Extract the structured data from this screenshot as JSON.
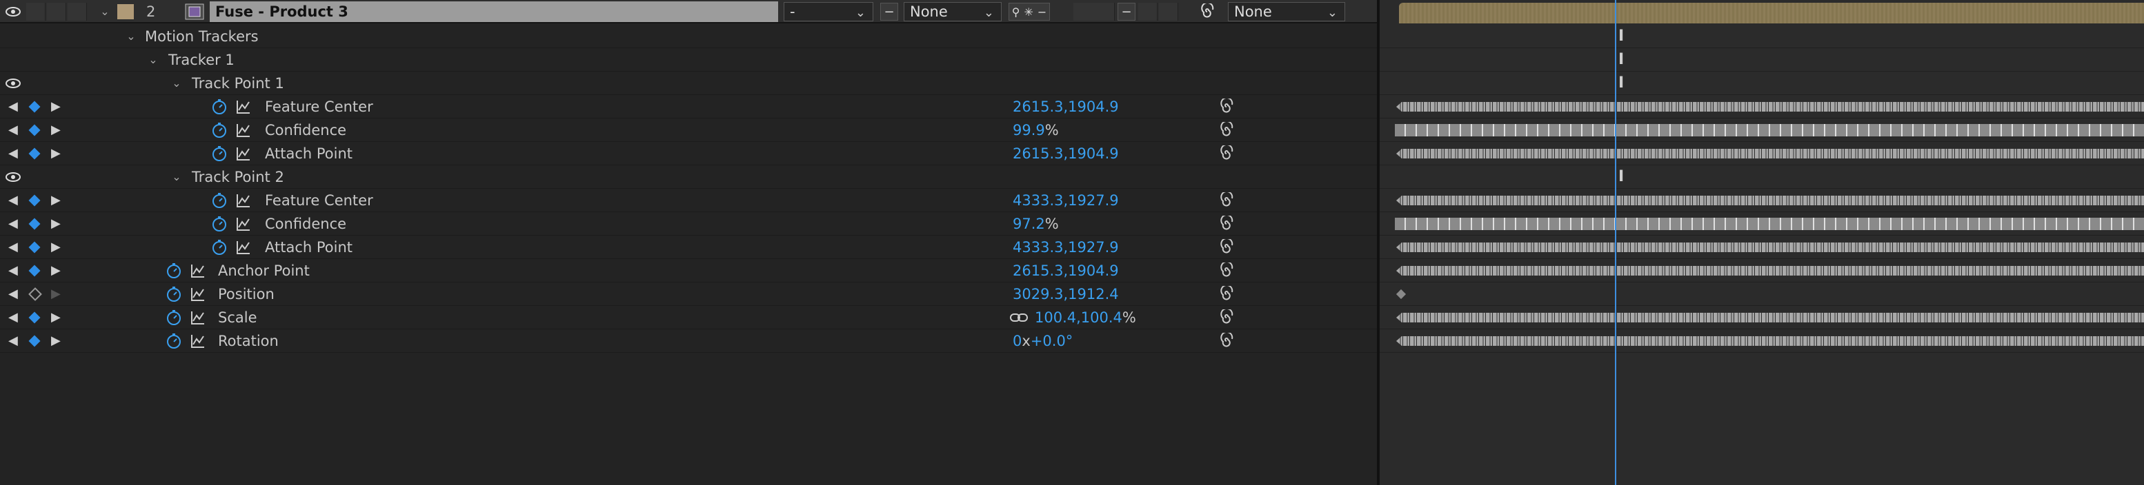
{
  "layer": {
    "number": "2",
    "name": "Fuse - Product 3",
    "color": "#b09a77",
    "mode_value": "-",
    "trkmat_value": "None",
    "parent_value": "None"
  },
  "groups": {
    "motion_trackers": "Motion Trackers",
    "tracker_1": "Tracker 1",
    "track_point_1": "Track Point 1",
    "track_point_2": "Track Point 2"
  },
  "properties": [
    {
      "label": "Feature Center",
      "value": "2615.3,1904.9",
      "unit": ""
    },
    {
      "label": "Confidence",
      "value": "99.9",
      "unit": "%"
    },
    {
      "label": "Attach Point",
      "value": "2615.3,1904.9",
      "unit": ""
    },
    {
      "label": "Feature Center",
      "value": "4333.3,1927.9",
      "unit": ""
    },
    {
      "label": "Confidence",
      "value": "97.2",
      "unit": "%"
    },
    {
      "label": "Attach Point",
      "value": "4333.3,1927.9",
      "unit": ""
    },
    {
      "label": "Anchor Point",
      "value": "2615.3,1904.9",
      "unit": ""
    },
    {
      "label": "Position",
      "value": "3029.3,1912.4",
      "unit": ""
    },
    {
      "label": "Scale",
      "value": "100.4,100.4",
      "unit": "%"
    },
    {
      "label": "Rotation",
      "value": "0",
      "unit_x": "x",
      "value2": "+0.0°"
    }
  ],
  "icons": {
    "eye": "eye-icon",
    "stopwatch": "stopwatch-icon",
    "graph": "graph-icon",
    "spiral": "expression-spiral-icon",
    "link": "chain-link-icon"
  },
  "colors": {
    "value_blue": "#3aa0f0",
    "keyframe_blue": "#2f8fe8",
    "playhead": "#3d8fe0"
  }
}
